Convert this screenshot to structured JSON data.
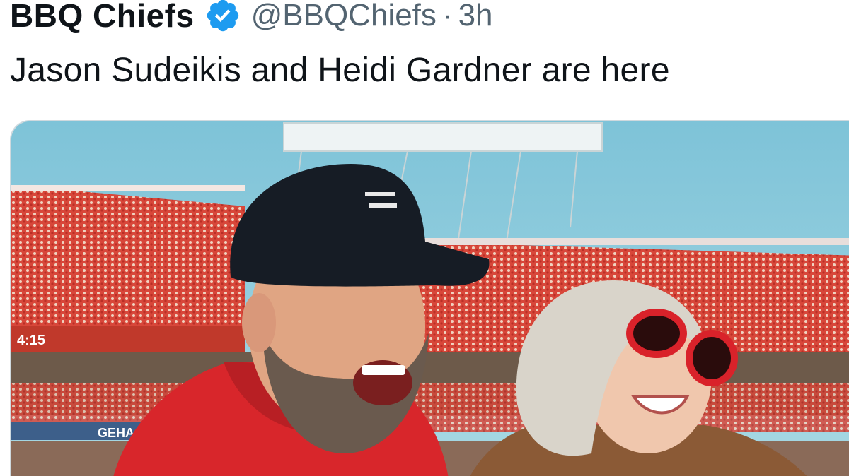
{
  "tweet": {
    "display_name": "BBQ Chiefs",
    "handle": "@BBQChiefs",
    "separator": "·",
    "time": "3h",
    "text": "Jason Sudeikis and Heidi Gardner are here"
  },
  "media": {
    "description_icon": "photo",
    "scoreboard_text": "4:15",
    "sign_text": "GEHA"
  },
  "colors": {
    "verified_blue": "#1d9bf0",
    "text_primary": "#0f1419",
    "text_secondary": "#536471"
  }
}
